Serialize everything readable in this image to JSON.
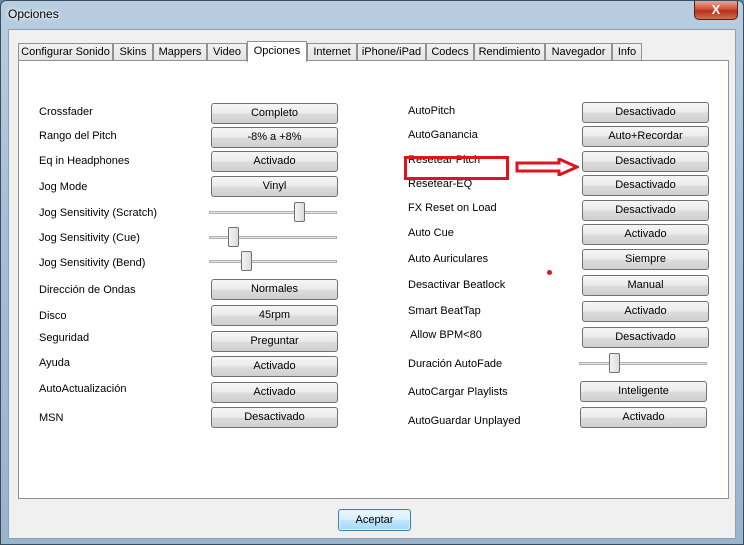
{
  "window": {
    "title": "Opciones",
    "close_glyph": "X"
  },
  "tabs": [
    {
      "label": "Configurar Sonido"
    },
    {
      "label": "Skins"
    },
    {
      "label": "Mappers"
    },
    {
      "label": "Video"
    },
    {
      "label": "Opciones"
    },
    {
      "label": "Internet"
    },
    {
      "label": "iPhone/iPad"
    },
    {
      "label": "Codecs"
    },
    {
      "label": "Rendimiento"
    },
    {
      "label": "Navegador"
    },
    {
      "label": "Info"
    }
  ],
  "active_tab": "Opciones",
  "left": {
    "crossfader": {
      "label": "Crossfader",
      "value": "Completo"
    },
    "pitch_range": {
      "label": "Rango del Pitch",
      "value": "-8% a +8%"
    },
    "eq_headphones": {
      "label": "Eq in Headphones",
      "value": "Activado"
    },
    "jog_mode": {
      "label": "Jog Mode",
      "value": "Vinyl"
    },
    "jog_scratch": {
      "label": "Jog Sensitivity (Scratch)",
      "level": 0.73
    },
    "jog_cue": {
      "label": "Jog Sensitivity (Cue)",
      "level": 0.16
    },
    "jog_bend": {
      "label": "Jog Sensitivity (Bend)",
      "level": 0.27
    },
    "wave_direction": {
      "label": "Dirección de Ondas",
      "value": "Normales"
    },
    "disc": {
      "label": "Disco",
      "value": "45rpm"
    },
    "security": {
      "label": "Seguridad",
      "value": "Preguntar"
    },
    "help": {
      "label": "Ayuda",
      "value": "Activado"
    },
    "autoupdate": {
      "label": "AutoActualización",
      "value": "Activado"
    },
    "msn": {
      "label": "MSN",
      "value": "Desactivado"
    }
  },
  "right": {
    "autopitch": {
      "label": "AutoPitch",
      "value": "Desactivado"
    },
    "autogain": {
      "label": "AutoGanancia",
      "value": "Auto+Recordar"
    },
    "reset_pitch": {
      "label": "Resetear Pitch",
      "value": "Desactivado"
    },
    "reset_eq": {
      "label": "Resetear-EQ",
      "value": "Desactivado"
    },
    "fx_reset": {
      "label": "FX Reset on Load",
      "value": "Desactivado"
    },
    "auto_cue": {
      "label": "Auto Cue",
      "value": "Activado"
    },
    "auto_headphones": {
      "label": "Auto Auriculares",
      "value": "Siempre"
    },
    "beatlock": {
      "label": "Desactivar Beatlock",
      "value": "Manual"
    },
    "smart_beattap": {
      "label": "Smart BeatTap",
      "value": "Activado"
    },
    "allow_bpm": {
      "label": "Allow BPM<80",
      "value": "Desactivado"
    },
    "autofade": {
      "label": "Duración AutoFade",
      "level": 0.26
    },
    "autoload_playlists": {
      "label": "AutoCargar Playlists",
      "value": "Inteligente"
    },
    "autosave_unplayed": {
      "label": "AutoGuardar Unplayed",
      "value": "Activado"
    }
  },
  "annotation": {
    "color": "#e0141c"
  },
  "footer": {
    "ok_label": "Aceptar"
  }
}
